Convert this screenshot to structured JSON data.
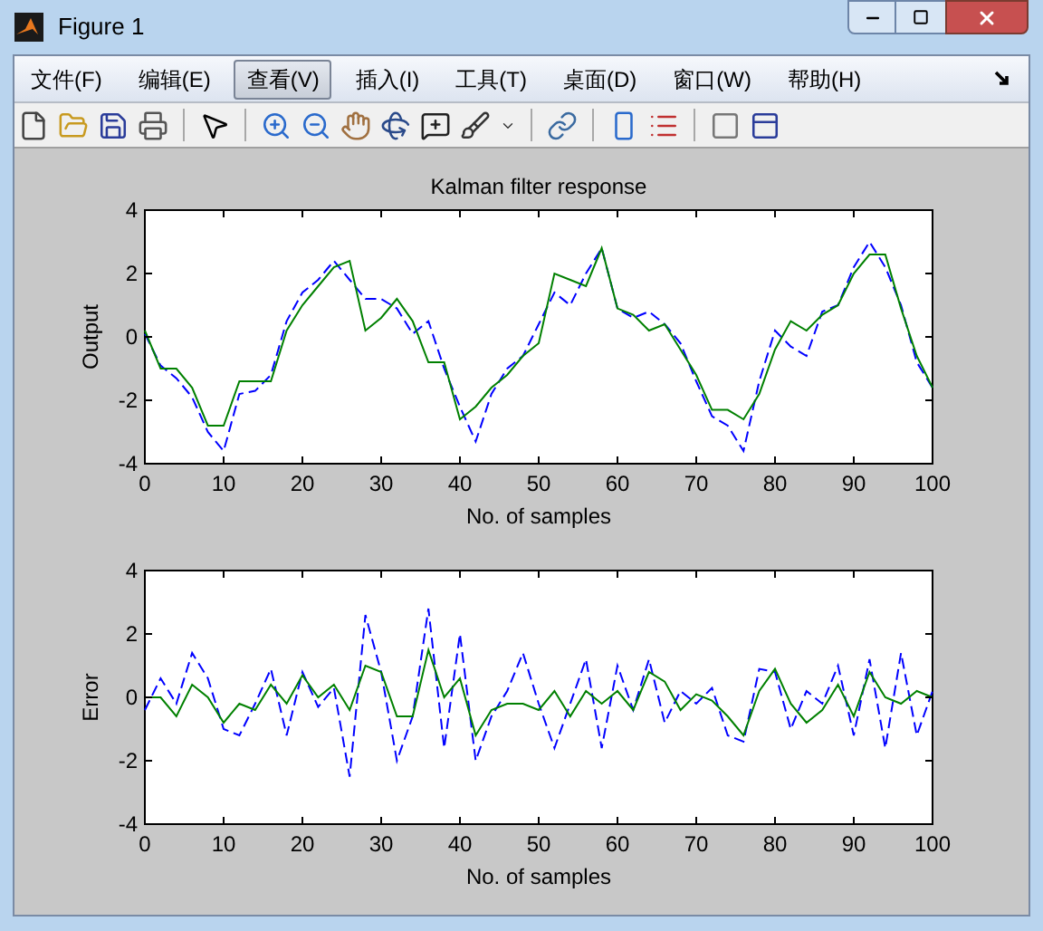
{
  "window": {
    "title": "Figure 1"
  },
  "menu": [
    {
      "label": "文件(F)",
      "selected": false
    },
    {
      "label": "编辑(E)",
      "selected": false
    },
    {
      "label": "查看(V)",
      "selected": true
    },
    {
      "label": "插入(I)",
      "selected": false
    },
    {
      "label": "工具(T)",
      "selected": false
    },
    {
      "label": "桌面(D)",
      "selected": false
    },
    {
      "label": "窗口(W)",
      "selected": false
    },
    {
      "label": "帮助(H)",
      "selected": false
    }
  ],
  "plots": [
    {
      "chart_data": {
        "type": "line",
        "title": "Kalman filter response",
        "xlabel": "No. of samples",
        "ylabel": "Output",
        "xlim": [
          0,
          100
        ],
        "ylim": [
          -4,
          4
        ],
        "xticks": [
          0,
          10,
          20,
          30,
          40,
          50,
          60,
          70,
          80,
          90,
          100
        ],
        "yticks": [
          -4,
          -2,
          0,
          2,
          4
        ],
        "x": [
          0,
          2,
          4,
          6,
          8,
          10,
          12,
          14,
          16,
          18,
          20,
          22,
          24,
          26,
          28,
          30,
          32,
          34,
          36,
          38,
          40,
          42,
          44,
          46,
          48,
          50,
          52,
          54,
          56,
          58,
          60,
          62,
          64,
          66,
          68,
          70,
          72,
          74,
          76,
          78,
          80,
          82,
          84,
          86,
          88,
          90,
          92,
          94,
          96,
          98,
          100
        ],
        "series": [
          {
            "color": "#0000ff",
            "line_style": "dashed",
            "values": [
              0.1,
              -0.9,
              -1.3,
              -1.9,
              -3.0,
              -3.6,
              -1.8,
              -1.7,
              -1.2,
              0.5,
              1.4,
              1.8,
              2.4,
              1.8,
              1.2,
              1.2,
              0.9,
              0.1,
              0.5,
              -1.0,
              -2.2,
              -3.3,
              -1.8,
              -1.0,
              -0.6,
              0.4,
              1.4,
              1.0,
              2.0,
              2.8,
              0.9,
              0.6,
              0.8,
              0.4,
              -0.2,
              -1.4,
              -2.5,
              -2.8,
              -3.6,
              -1.4,
              0.2,
              -0.3,
              -0.6,
              0.8,
              1.0,
              2.2,
              3.0,
              2.2,
              1.0,
              -0.8,
              -1.6
            ]
          },
          {
            "color": "#008000",
            "line_style": "solid",
            "values": [
              0.2,
              -1.0,
              -1.0,
              -1.6,
              -2.8,
              -2.8,
              -1.4,
              -1.4,
              -1.4,
              0.2,
              1.0,
              1.6,
              2.2,
              2.4,
              0.2,
              0.6,
              1.2,
              0.5,
              -0.8,
              -0.8,
              -2.6,
              -2.2,
              -1.6,
              -1.2,
              -0.6,
              -0.2,
              2.0,
              1.8,
              1.6,
              2.8,
              0.9,
              0.7,
              0.2,
              0.4,
              -0.4,
              -1.2,
              -2.3,
              -2.3,
              -2.6,
              -1.8,
              -0.4,
              0.5,
              0.2,
              0.7,
              1.0,
              2.0,
              2.6,
              2.6,
              0.9,
              -0.6,
              -1.6
            ]
          }
        ]
      }
    },
    {
      "chart_data": {
        "type": "line",
        "xlabel": "No. of samples",
        "ylabel": "Error",
        "xlim": [
          0,
          100
        ],
        "ylim": [
          -4,
          4
        ],
        "xticks": [
          0,
          10,
          20,
          30,
          40,
          50,
          60,
          70,
          80,
          90,
          100
        ],
        "yticks": [
          -4,
          -2,
          0,
          2,
          4
        ],
        "x": [
          0,
          2,
          4,
          6,
          8,
          10,
          12,
          14,
          16,
          18,
          20,
          22,
          24,
          26,
          28,
          30,
          32,
          34,
          36,
          38,
          40,
          42,
          44,
          46,
          48,
          50,
          52,
          54,
          56,
          58,
          60,
          62,
          64,
          66,
          68,
          70,
          72,
          74,
          76,
          78,
          80,
          82,
          84,
          86,
          88,
          90,
          92,
          94,
          96,
          98,
          100
        ],
        "series": [
          {
            "color": "#0000ff",
            "line_style": "dashed",
            "values": [
              -0.4,
              0.6,
              -0.2,
              1.4,
              0.6,
              -1.0,
              -1.2,
              -0.2,
              0.9,
              -1.2,
              0.8,
              -0.3,
              0.3,
              -2.5,
              2.6,
              0.8,
              -2.0,
              -0.6,
              2.8,
              -1.6,
              2.0,
              -2.0,
              -0.6,
              0.2,
              1.4,
              -0.2,
              -1.6,
              -0.2,
              1.2,
              -1.6,
              1.0,
              -0.4,
              1.2,
              -0.8,
              0.2,
              -0.2,
              0.3,
              -1.2,
              -1.4,
              0.9,
              0.8,
              -1.0,
              0.2,
              -0.2,
              1.0,
              -1.2,
              1.2,
              -1.6,
              1.4,
              -1.2,
              0.2
            ]
          },
          {
            "color": "#008000",
            "line_style": "solid",
            "values": [
              0,
              0,
              -0.6,
              0.4,
              0,
              -0.8,
              -0.2,
              -0.4,
              0.4,
              -0.2,
              0.7,
              0,
              0.4,
              -0.4,
              1.0,
              0.8,
              -0.6,
              -0.6,
              1.5,
              0,
              0.6,
              -1.2,
              -0.4,
              -0.2,
              -0.2,
              -0.4,
              0.2,
              -0.6,
              0.2,
              -0.2,
              0.2,
              -0.4,
              0.8,
              0.5,
              -0.4,
              0.1,
              -0.1,
              -0.6,
              -1.2,
              0.2,
              0.9,
              -0.2,
              -0.8,
              -0.4,
              0.4,
              -0.6,
              0.8,
              0,
              -0.2,
              0.2,
              0
            ]
          }
        ]
      }
    }
  ]
}
